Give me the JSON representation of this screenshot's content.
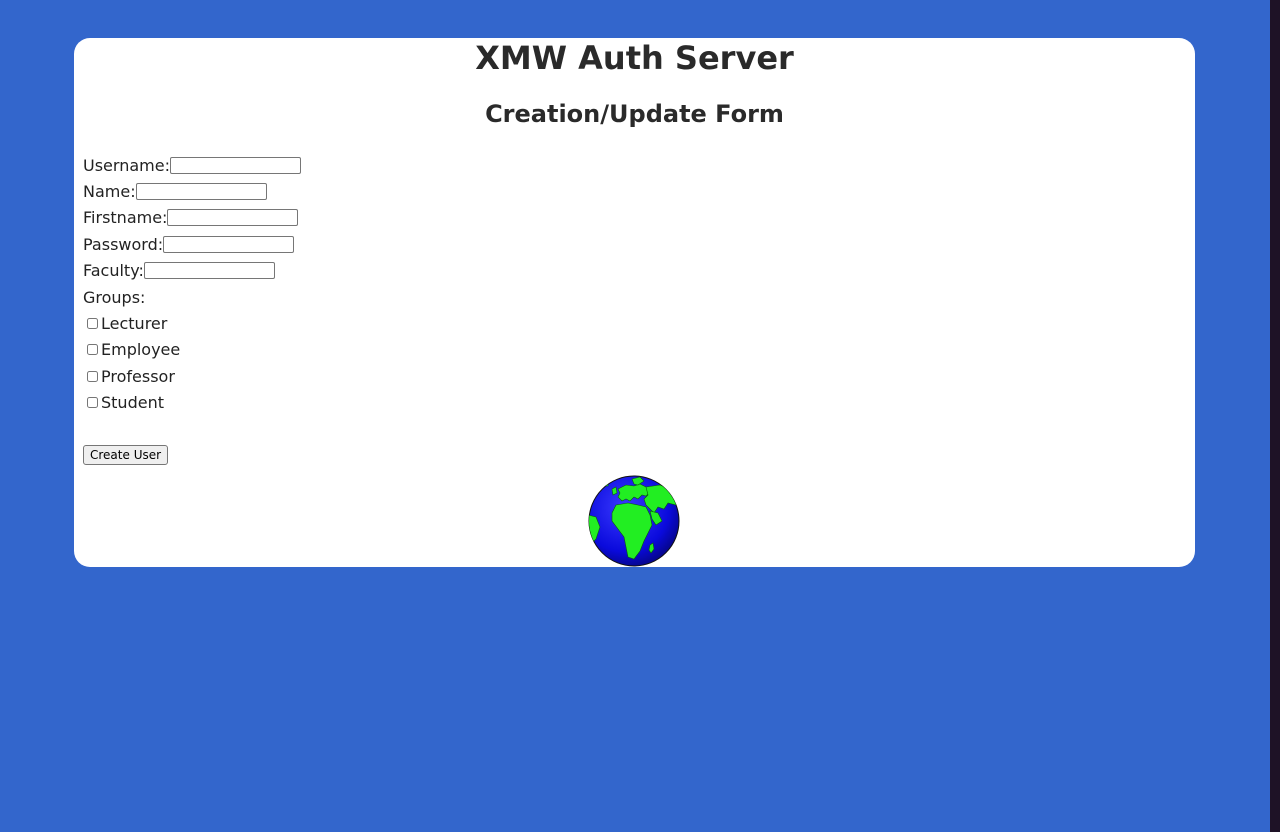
{
  "page": {
    "title": "XMW Auth Server",
    "subtitle": "Creation/Update Form",
    "background_color": "#3366cc"
  },
  "form": {
    "fields": [
      {
        "label": "Username:",
        "value": "",
        "type": "text"
      },
      {
        "label": "Name:",
        "value": "",
        "type": "text"
      },
      {
        "label": "Firstname:",
        "value": "",
        "type": "text"
      },
      {
        "label": "Password:",
        "value": "",
        "type": "password"
      },
      {
        "label": "Faculty:",
        "value": "",
        "type": "text"
      }
    ],
    "groups_label": "Groups:",
    "groups": [
      {
        "label": "Lecturer",
        "checked": false
      },
      {
        "label": "Employee",
        "checked": false
      },
      {
        "label": "Professor",
        "checked": false
      },
      {
        "label": "Student",
        "checked": false
      }
    ],
    "submit_label": "Create User"
  },
  "footer": {
    "icon": "globe-icon"
  }
}
